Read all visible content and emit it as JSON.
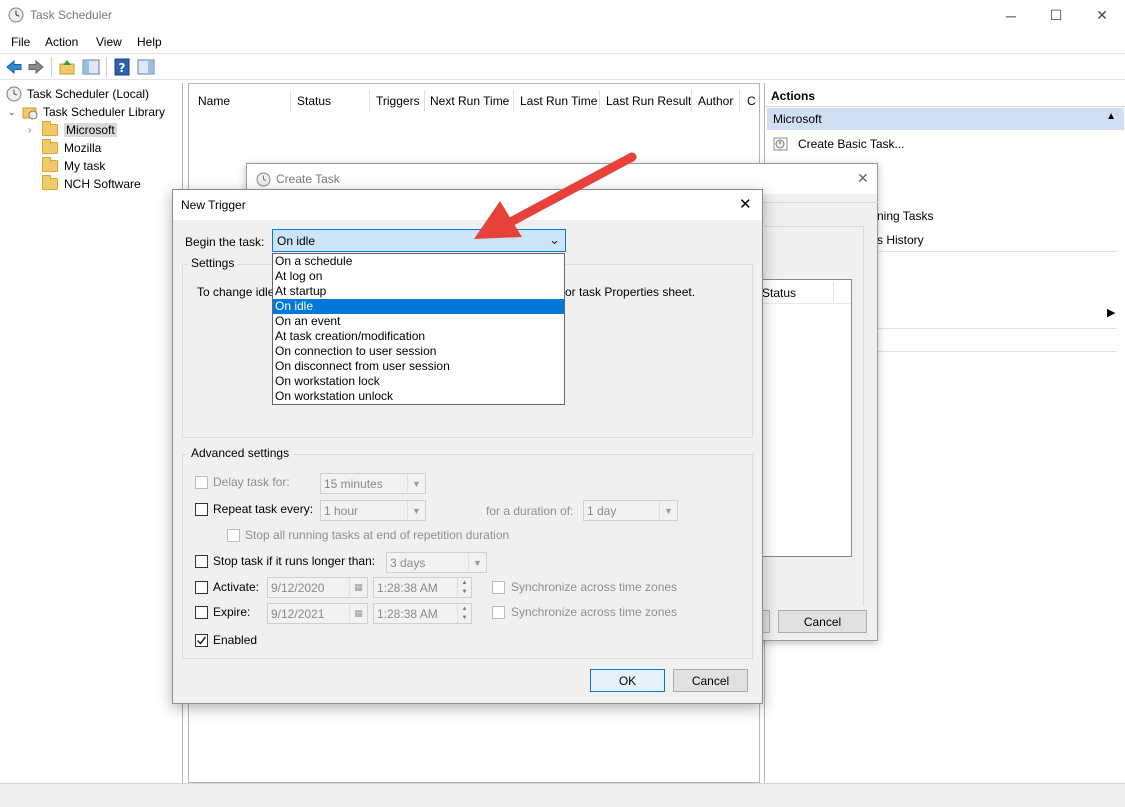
{
  "app": {
    "title": "Task Scheduler",
    "minimize_glyph": "─",
    "maximize_glyph": "☐",
    "close_glyph": "✕"
  },
  "menu": [
    "File",
    "Action",
    "View",
    "Help"
  ],
  "toolbar_icons": [
    "back-arrow-icon",
    "forward-arrow-icon",
    "up-folder-icon",
    "show-hide-console-tree-icon",
    "help-icon",
    "show-hide-action-pane-icon"
  ],
  "tree": {
    "root": "Task Scheduler (Local)",
    "library": "Task Scheduler Library",
    "folders": [
      "Microsoft",
      "Mozilla",
      "My task",
      "NCH Software"
    ],
    "selected": "Microsoft"
  },
  "task_list": {
    "columns": [
      "Name",
      "Status",
      "Triggers",
      "Next Run Time",
      "Last Run Time",
      "Last Run Result",
      "Author",
      "C"
    ]
  },
  "actions_pane": {
    "header": "Actions",
    "section": "Microsoft",
    "items": [
      "Create Basic Task...",
      "ning Tasks",
      "s History"
    ]
  },
  "create_task": {
    "title": "Create Task",
    "column_status": "Status",
    "cancel_label": "Cancel"
  },
  "new_trigger": {
    "title": "New Trigger",
    "begin_label": "Begin the task:",
    "begin_value": "On idle",
    "settings_label": "Settings",
    "settings_text_start": "To change idle",
    "settings_text_end": "or task Properties sheet.",
    "begin_options": [
      "On a schedule",
      "At log on",
      "At startup",
      "On idle",
      "On an event",
      "At task creation/modification",
      "On connection to user session",
      "On disconnect from user session",
      "On workstation lock",
      "On workstation unlock"
    ],
    "selected_index": 3,
    "advanced": {
      "label": "Advanced settings",
      "delay_label": "Delay task for:",
      "delay_value": "15 minutes",
      "repeat_label": "Repeat task every:",
      "repeat_value": "1 hour",
      "duration_label": "for a duration of:",
      "duration_value": "1 day",
      "stop_running_label": "Stop all running tasks at end of repetition duration",
      "stop_longer_label": "Stop task if it runs longer than:",
      "stop_longer_value": "3 days",
      "activate_label": "Activate:",
      "activate_date": "9/12/2020",
      "activate_time": "1:28:38 AM",
      "expire_label": "Expire:",
      "expire_date": "9/12/2021",
      "expire_time": "1:28:38 AM",
      "sync_label": "Synchronize across time zones",
      "enabled_label": "Enabled",
      "enabled_checked": true
    },
    "ok_label": "OK",
    "cancel_label": "Cancel"
  },
  "colors": {
    "selection": "#0078d7",
    "annotation_arrow": "#e8413a",
    "section_header": "#cfe0f3"
  }
}
